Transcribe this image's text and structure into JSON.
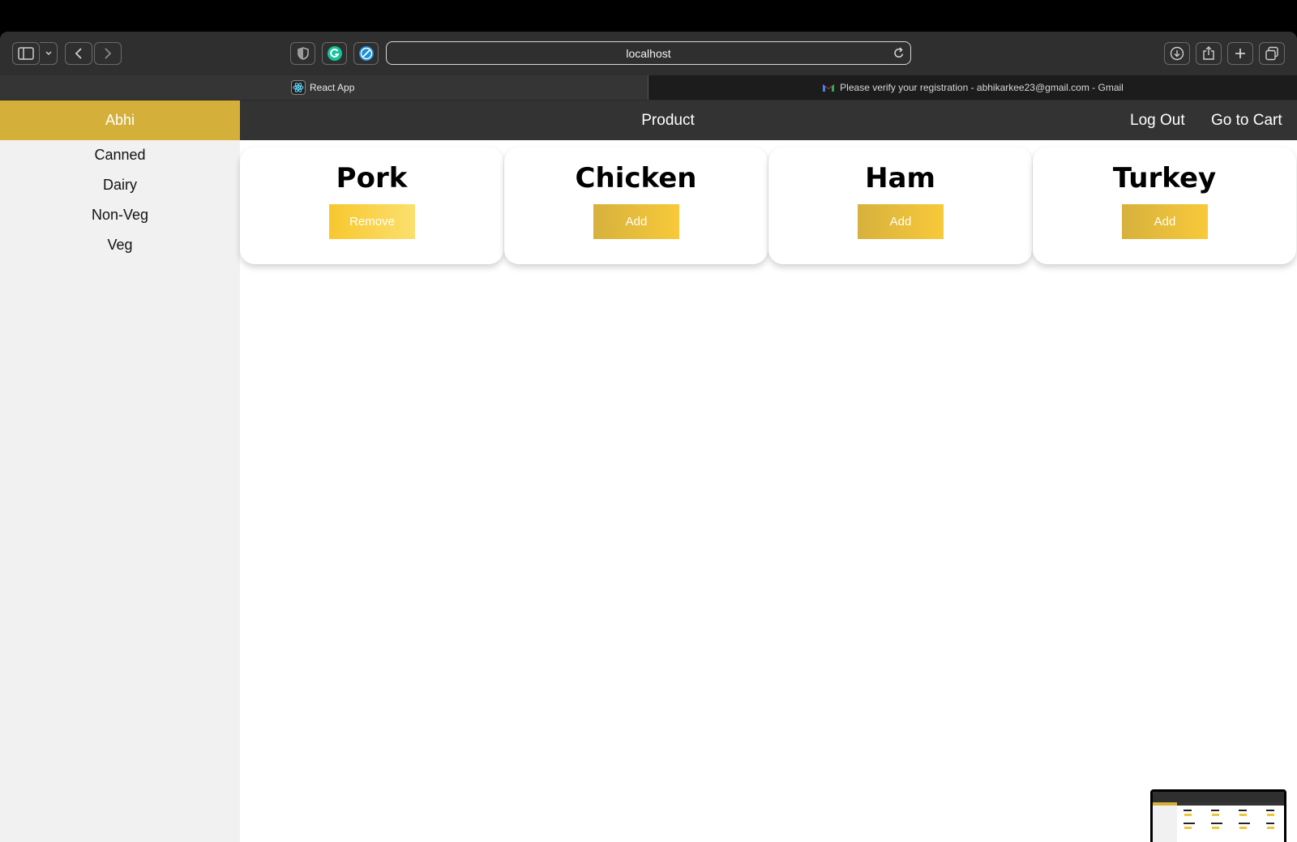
{
  "browser": {
    "url": "localhost",
    "tabs": [
      {
        "label": "React App",
        "icon": "react-icon",
        "active": true
      },
      {
        "label": "Please verify your registration - abhikarkee23@gmail.com - Gmail",
        "icon": "gmail-icon",
        "active": false
      }
    ]
  },
  "sidebar": {
    "user": "Abhi",
    "categories": [
      "Canned",
      "Dairy",
      "Non-Veg",
      "Veg"
    ]
  },
  "navbar": {
    "title": "Product",
    "logout": "Log Out",
    "cart": "Go to Cart"
  },
  "products": [
    {
      "name": "Pork",
      "button": "Remove"
    },
    {
      "name": "Chicken",
      "button": "Add"
    },
    {
      "name": "Ham",
      "button": "Add"
    },
    {
      "name": "Turkey",
      "button": "Add"
    }
  ],
  "colors": {
    "accent": "#d4b03b",
    "navbar": "#333333",
    "sidebar": "#f1f1f1"
  }
}
